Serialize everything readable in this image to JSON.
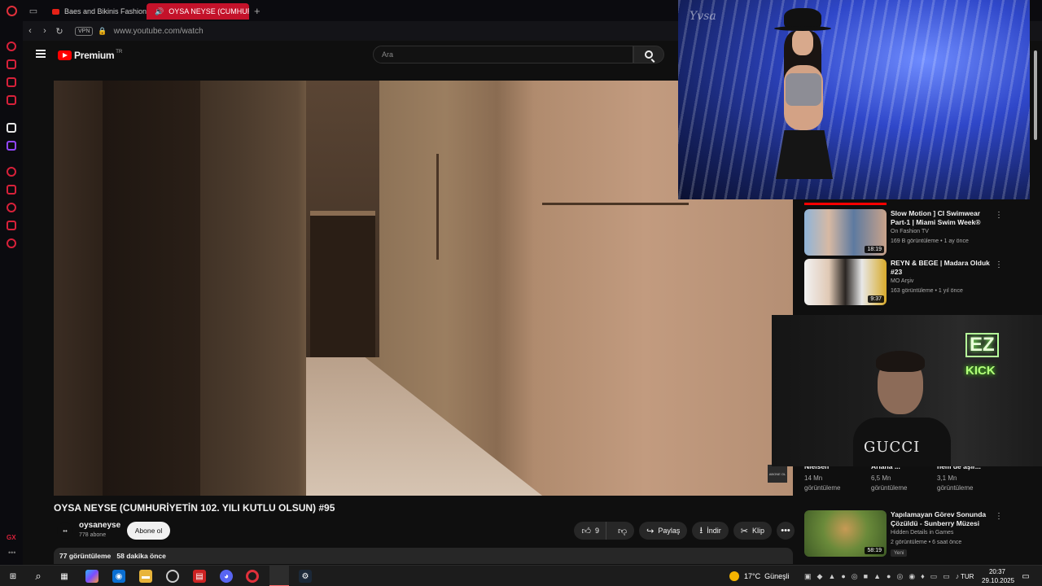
{
  "browser": {
    "tabs": [
      {
        "label": "Baes and Bikinis Fashion"
      },
      {
        "label": "OYSA NEYSE (CUMHURİ"
      }
    ],
    "new_tab": "+",
    "vpn": "VPN",
    "url": "www.youtube.com/watch"
  },
  "youtube": {
    "logo_text": "Premium",
    "region": "TR",
    "search_placeholder": "Ara"
  },
  "video": {
    "title": "OYSA NEYSE (CUMHURİYETİN 102. YILI KUTLU OLSUN) #95",
    "watermark": "ABONE OL",
    "channel": {
      "avatar_text": "••",
      "name": "oysaneyse",
      "subscribers": "778 abone",
      "subscribe_label": "Abone ol"
    },
    "actions": {
      "likes": "9",
      "share": "Paylaş",
      "download": "İndir",
      "clip": "Klip",
      "more": "•••"
    },
    "views": "77 görüntüleme",
    "uploaded": "58 dakika önce"
  },
  "overlays": {
    "runway_logo": "Yvsa",
    "webcam_shirt": "GUCCI",
    "neon_ez": "EZ",
    "neon_kick": "KICK"
  },
  "recommendations": [
    {
      "title": "Slow Motion ] CI Swimwear Part-1 | Miami Swim Week® -...",
      "channel": "On Fashion TV",
      "meta": "169 B görüntüleme • 1 ay önce",
      "duration": "18:19",
      "thumb_color": "#5d7aa0"
    },
    {
      "title": "REYN & BEGE | Madara Olduk #23",
      "channel": "MO Arşiv",
      "meta": "163 görüntüleme • 1 yıl önce",
      "duration": "9:37",
      "thumb_color": "#e8e8e8"
    },
    {
      "title": "Yapılamayan Görev Sonunda Çözüldü - Sunberry Müzesi Pa...",
      "channel": "Hidden Details in Games",
      "meta": "2 görüntüleme • 6 saat önce",
      "duration": "58:19",
      "badge": "Yeni",
      "thumb_color": "#4f6e3a"
    }
  ],
  "cut_row": [
    {
      "title": "Nielsen",
      "views": "14 Mn",
      "unit": "görüntüleme"
    },
    {
      "title": "Ariana ...",
      "views": "6,5 Mn",
      "unit": "görüntüleme"
    },
    {
      "title": "nem de aşır...",
      "views": "3,1 Mn",
      "unit": "görüntüleme"
    }
  ],
  "taskbar": {
    "weather": "17°C",
    "weather_desc": "Güneşli",
    "language": "TUR",
    "time": "20:37",
    "date": "29.10.2025"
  },
  "colors": {
    "accent_red": "#ff0000",
    "opera_red": "#c4122a",
    "kick_green": "#53fc18"
  }
}
